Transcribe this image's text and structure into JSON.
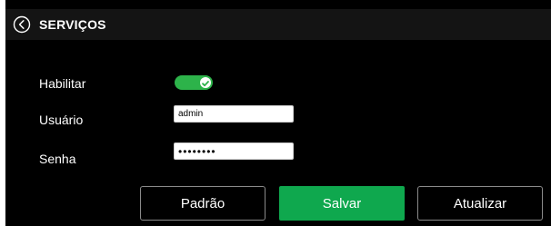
{
  "header": {
    "title": "SERVIÇOS",
    "back_icon": "chevron-left-circle-icon"
  },
  "form": {
    "enable": {
      "label": "Habilitar",
      "checked": true,
      "color": "#2db34a"
    },
    "user": {
      "label": "Usuário",
      "value": "admin"
    },
    "password": {
      "label": "Senha",
      "value": "••••••••"
    }
  },
  "actions": {
    "default_label": "Padrão",
    "save_label": "Salvar",
    "refresh_label": "Atualizar",
    "save_color": "#0fa84e"
  }
}
